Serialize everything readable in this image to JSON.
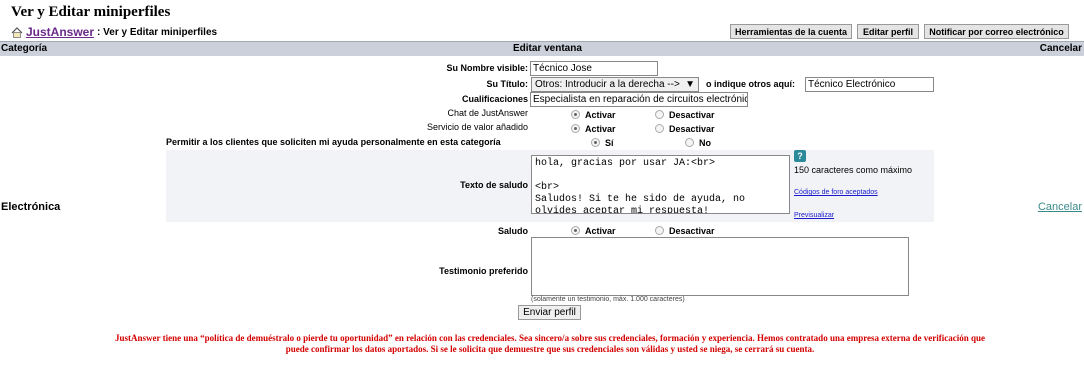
{
  "page": {
    "title": "Ver y Editar miniperfiles",
    "breadcrumb_link": "JustAnswer",
    "breadcrumb_text": ": Ver y Editar miniperfiles"
  },
  "top_buttons": {
    "account_tools": "Herramientas de la cuenta",
    "edit_profile": "Editar perfil",
    "email_notify": "Notificar por correo electrónico"
  },
  "header": {
    "category": "Categoría",
    "edit_window": "Editar ventana",
    "cancel": "Cancelar"
  },
  "row": {
    "category_name": "Electrónica",
    "cancel_link": "Cancelar"
  },
  "form": {
    "visible_name_label": "Su Nombre visible:",
    "visible_name_value": "Técnico Jose",
    "title_label": "Su Título:",
    "title_select": "Otros: Introducir a la derecha -->",
    "title_other_label": "o indique otros aquí:",
    "title_other_value": "Técnico Electrónico",
    "qualifications_label": "Cualificaciones",
    "qualifications_value": "Especialista en reparación de circuitos electrónic",
    "chat_label": "Chat de JustAnswer",
    "value_service_label": "Servicio de valor añadido",
    "allow_label": "Permitir a los clientes que soliciten mi ayuda personalmente en esta categoría",
    "activate": "Activar",
    "deactivate": "Desactivar",
    "yes": "Sí",
    "no": "No",
    "greeting_text_label": "Texto de saludo",
    "greeting_text_value": "hola, gracias por usar JA:<br>\n\n<br>\nSaludos! Si te he sido de ayuda, no\nolvides aceptar mi respuesta!",
    "help_icon": "?",
    "max_chars": "150 caracteres como máximo",
    "forum_codes_link": "Códigos de foro aceptados",
    "preview_link": "Previsualizar",
    "greeting_label": "Saludo",
    "testimonial_label": "Testimonio preferido",
    "testimonial_value": "",
    "testimonial_note": "(solamente un testimonio, máx. 1.000 caracteres)",
    "submit": "Enviar perfil"
  },
  "radios": {
    "chat": "activar",
    "value_service": "activar",
    "allow": "si",
    "greeting": "activar"
  },
  "warning": {
    "line1": "JustAnswer tiene una “política de demuéstralo o pierde tu oportunidad” en relación con las credenciales. Sea sincero/a sobre sus credenciales, formación y experiencia. Hemos contratado una empresa externa de verificación que",
    "line2": "puede confirmar los datos aportados. Si se le solicita que demuestre que sus credenciales son válidas y usted se niega, se cerrará su cuenta."
  },
  "colors": {
    "header_bar": "#cbd0da",
    "link_purple": "#6a2a8a",
    "warning_red": "#d40000",
    "cancel_link": "#3a8a8a",
    "help_icon": "#2a8a9a"
  }
}
